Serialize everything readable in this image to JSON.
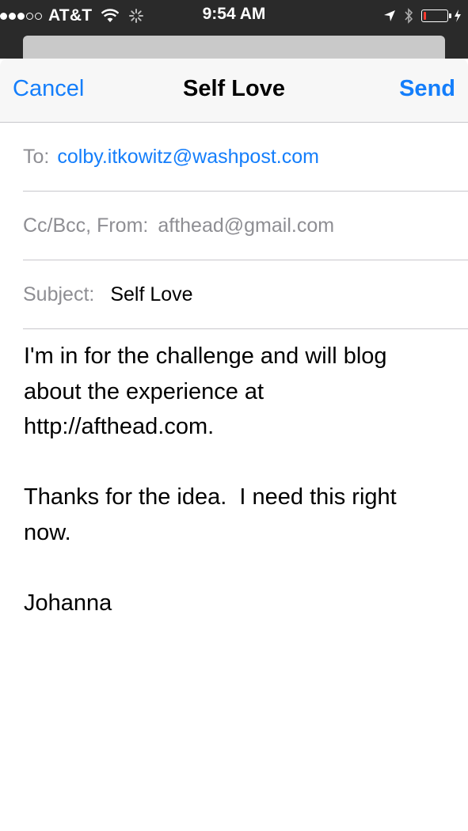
{
  "status_bar": {
    "carrier": "AT&T",
    "time": "9:54 AM",
    "signal_filled": 3,
    "signal_total": 5,
    "battery_level": 0.1,
    "battery_color": "#ff3b30",
    "icons": [
      "wifi-icon",
      "activity-spinner-icon",
      "location-arrow-icon",
      "bluetooth-icon",
      "battery-icon",
      "charging-bolt-icon"
    ]
  },
  "nav": {
    "cancel_label": "Cancel",
    "title": "Self Love",
    "send_label": "Send"
  },
  "fields": {
    "to_label": "To:",
    "to_value": "colby.itkowitz@washpost.com",
    "cc_label": "Cc/Bcc, From:",
    "from_value": "afthead@gmail.com",
    "subject_label": "Subject:",
    "subject_value": "Self Love"
  },
  "body_text": "I'm in for the challenge and will blog\nabout the experience at\nhttp://afthead.com.\n\nThanks for the idea.  I need this right\nnow.\n\nJohanna",
  "colors": {
    "accent": "#147efb",
    "label_gray": "#8e8e93",
    "separator": "#c8c7cc",
    "status_bar_bg": "#2a2a2a"
  }
}
